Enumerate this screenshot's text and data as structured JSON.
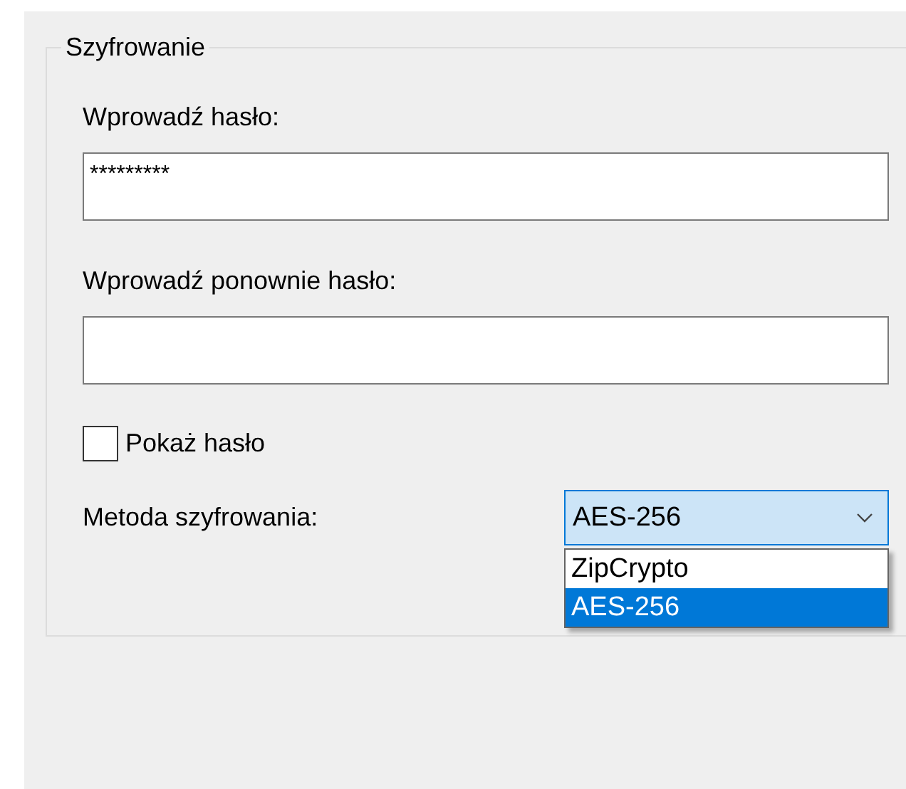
{
  "group": {
    "title": "Szyfrowanie"
  },
  "password": {
    "label": "Wprowadź hasło:",
    "value": "*********"
  },
  "confirm": {
    "label": "Wprowadź ponownie hasło:"
  },
  "show_password": {
    "label": "Pokaż hasło",
    "checked": false
  },
  "method": {
    "label": "Metoda szyfrowania:",
    "value": "AES-256",
    "expanded": true,
    "options": [
      {
        "label": "ZipCrypto",
        "selected": false
      },
      {
        "label": "AES-256",
        "selected": true
      }
    ]
  }
}
